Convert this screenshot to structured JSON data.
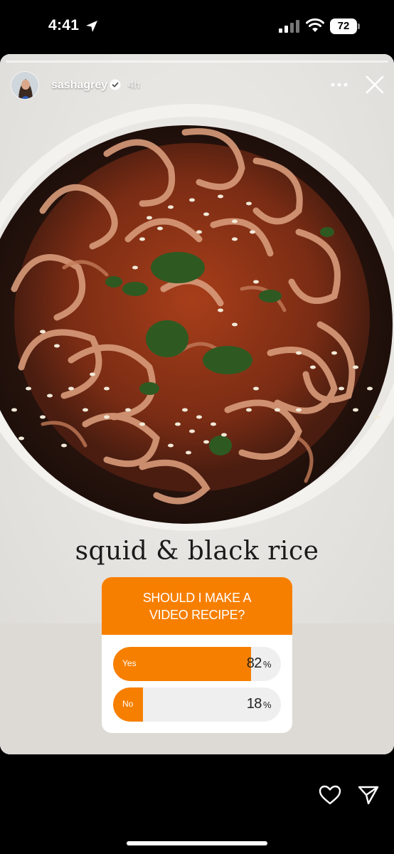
{
  "status_bar": {
    "time": "4:41",
    "battery": "72",
    "icons": [
      "location-arrow-icon",
      "signal-icon",
      "wifi-icon",
      "battery-icon"
    ]
  },
  "story": {
    "progress": {
      "total_segments": 1,
      "completed_segments": 0
    },
    "username": "sashagrey",
    "verified": true,
    "age": "4h",
    "caption": "squid & black rice",
    "colors": {
      "accent": "#f77f00",
      "track": "#efefef"
    }
  },
  "poll": {
    "question": "SHOULD I MAKE A VIDEO RECIPE?",
    "options": [
      {
        "label": "Yes",
        "percent": 82,
        "percent_text": "82"
      },
      {
        "label": "No",
        "percent": 18,
        "percent_text": "18"
      }
    ],
    "percent_sign": "%"
  },
  "actions": {
    "icons": [
      "heart-icon",
      "send-icon",
      "more-icon",
      "close-icon"
    ]
  }
}
